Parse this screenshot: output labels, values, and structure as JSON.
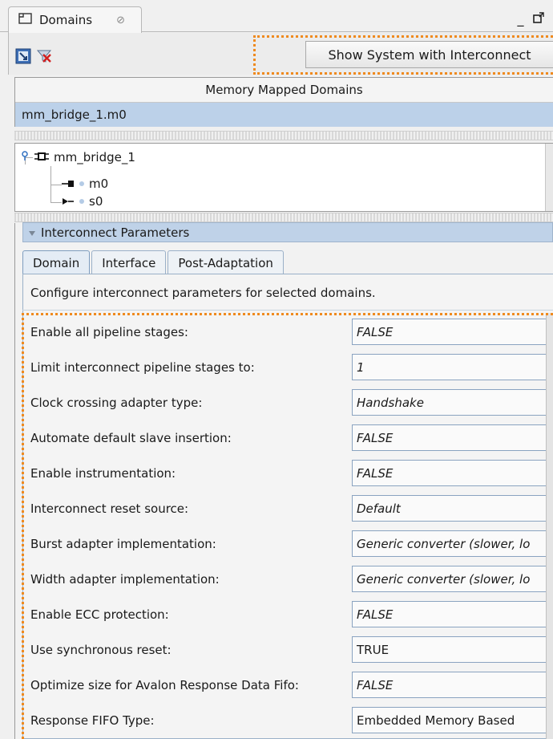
{
  "window": {
    "tab_title": "Domains",
    "tab_close_glyph": "⊘",
    "minimize_glyph": "_",
    "maximize_glyph": "❐"
  },
  "toolbar": {
    "show_system_label": "Show System with Interconnect",
    "icons": [
      "add-domain-icon",
      "remove-domain-icon"
    ]
  },
  "domains_table": {
    "header": "Memory Mapped Domains",
    "rows": [
      "mm_bridge_1.m0"
    ]
  },
  "tree": {
    "root": "mm_bridge_1",
    "children": [
      "m0",
      "s0"
    ]
  },
  "params": {
    "section_title": "Interconnect Parameters",
    "tabs": [
      "Domain",
      "Interface",
      "Post-Adaptation"
    ],
    "description": "Configure interconnect parameters for selected domains.",
    "rows": [
      {
        "label": "Enable all pipeline stages:",
        "value": "FALSE"
      },
      {
        "label": "Limit interconnect pipeline stages to:",
        "value": "1"
      },
      {
        "label": "Clock crossing adapter type:",
        "value": "Handshake"
      },
      {
        "label": "Automate default slave insertion:",
        "value": "FALSE"
      },
      {
        "label": "Enable instrumentation:",
        "value": "FALSE"
      },
      {
        "label": "Interconnect reset source:",
        "value": "Default"
      },
      {
        "label": "Burst adapter implementation:",
        "value": "Generic converter (slower, lo"
      },
      {
        "label": "Width adapter implementation:",
        "value": "Generic converter (slower, lo"
      },
      {
        "label": "Enable ECC protection:",
        "value": "FALSE"
      },
      {
        "label": "Use synchronous reset:",
        "value": "TRUE"
      },
      {
        "label": "Optimize size for Avalon Response Data Fifo:",
        "value": "FALSE"
      },
      {
        "label": "Response FIFO Type:",
        "value": "Embedded Memory Based"
      }
    ]
  },
  "colors": {
    "selection": "#bcd1e9",
    "highlight": "#ef8a1f",
    "section_header": "#bfd2e8"
  }
}
